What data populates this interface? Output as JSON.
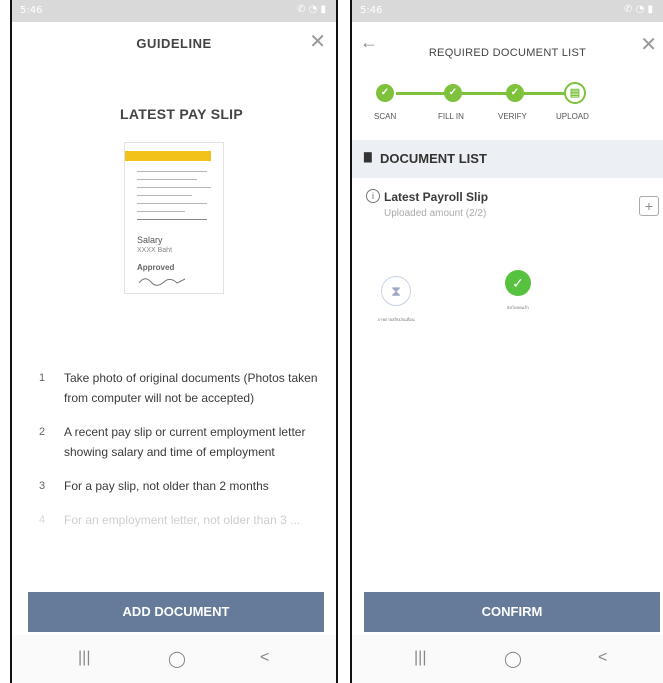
{
  "left_screen": {
    "status": {
      "time": "5:46",
      "right": "✆ ◔ ▮"
    },
    "header": {
      "title": "GUIDELINE",
      "close": "✕"
    },
    "document_title": "LATEST PAY SLIP",
    "illustration": {
      "salary": "Salary",
      "amount": "XXXX Baht",
      "approved": "Approved"
    },
    "instructions": [
      {
        "num": "1",
        "text": "Take photo of original documents (Photos taken from computer will not be accepted)"
      },
      {
        "num": "2",
        "text": "A recent pay slip or current employment letter showing salary and time of employment"
      },
      {
        "num": "3",
        "text": "For a pay slip, not older than 2 months"
      },
      {
        "num": "4",
        "text": "For an employment letter, not older than 3 ..."
      }
    ],
    "button": "ADD DOCUMENT",
    "nav": {
      "recents": "|||",
      "home": "◯",
      "back": "<"
    }
  },
  "right_screen": {
    "status": {
      "time": "5:46",
      "right": "✆ ◔ ▮"
    },
    "header": {
      "title": "REQUIRED DOCUMENT LIST",
      "back": "←",
      "close": "✕"
    },
    "steps": [
      {
        "label": "SCAN",
        "state": "done"
      },
      {
        "label": "FILL IN",
        "state": "done"
      },
      {
        "label": "VERIFY",
        "state": "done"
      },
      {
        "label": "UPLOAD",
        "state": "current"
      }
    ],
    "section_title": "DOCUMENT LIST",
    "document": {
      "name": "Latest Payroll Slip",
      "count": "Uploaded amount (2/2)",
      "add": "+"
    },
    "thumbnails": [
      {
        "caption": "ภาพถ่ายสลิปเงินเดือน",
        "state": "pending"
      },
      {
        "caption": "อัปโหลดแล้ว",
        "state": "done"
      }
    ],
    "button": "CONFIRM",
    "nav": {
      "recents": "|||",
      "home": "◯",
      "back": "<"
    }
  },
  "colors": {
    "accent_green": "#7ec23b",
    "button_blue": "#667a9a",
    "payslip_yellow": "#f2c21b"
  }
}
